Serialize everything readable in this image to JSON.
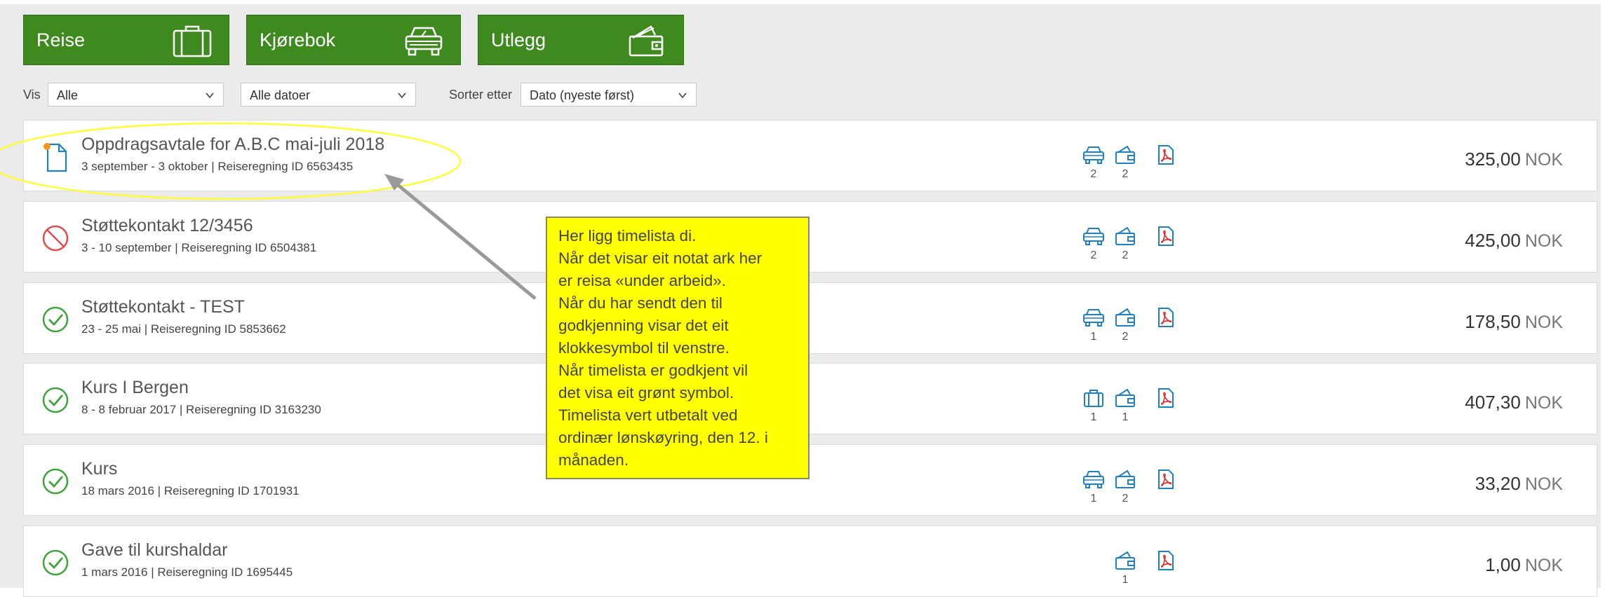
{
  "buttons": [
    {
      "label": "Reise",
      "icon": "suitcase-icon"
    },
    {
      "label": "Kjørebok",
      "icon": "car-icon"
    },
    {
      "label": "Utlegg",
      "icon": "wallet-icon"
    }
  ],
  "filters": {
    "vis_label": "Vis",
    "vis_value": "Alle",
    "date_value": "Alle datoer",
    "sort_label": "Sorter etter",
    "sort_value": "Dato (nyeste først)"
  },
  "trips": [
    {
      "status": "note-icon",
      "title": "Oppdragsavtale for A.B.C mai-juli 2018",
      "subtitle": "3 september - 3 oktober | Reiseregning ID 6563435",
      "amount": "325,00",
      "currency": "NOK",
      "icons": [
        {
          "icon": "car-icon",
          "count": "2"
        },
        {
          "icon": "wallet-icon",
          "count": "2"
        },
        {
          "icon": "pdf-icon",
          "count": ""
        }
      ]
    },
    {
      "status": "prohibited-icon",
      "title": "Støttekontakt 12/3456",
      "subtitle": "3 - 10 september | Reiseregning ID 6504381",
      "amount": "425,00",
      "currency": "NOK",
      "icons": [
        {
          "icon": "car-icon",
          "count": "2"
        },
        {
          "icon": "wallet-icon",
          "count": "2"
        },
        {
          "icon": "pdf-icon",
          "count": ""
        }
      ]
    },
    {
      "status": "check-circle-icon",
      "title": "Støttekontakt - TEST",
      "subtitle": "23 - 25 mai | Reiseregning ID 5853662",
      "amount": "178,50",
      "currency": "NOK",
      "icons": [
        {
          "icon": "car-icon",
          "count": "1"
        },
        {
          "icon": "wallet-icon",
          "count": "2"
        },
        {
          "icon": "pdf-icon",
          "count": ""
        }
      ]
    },
    {
      "status": "check-circle-icon",
      "title": "Kurs I Bergen",
      "subtitle": "8 - 8 februar 2017 | Reiseregning ID 3163230",
      "amount": "407,30",
      "currency": "NOK",
      "icons": [
        {
          "icon": "suitcase-icon",
          "count": "1"
        },
        {
          "icon": "wallet-icon",
          "count": "1"
        },
        {
          "icon": "pdf-icon",
          "count": ""
        }
      ]
    },
    {
      "status": "check-circle-icon",
      "title": "Kurs",
      "subtitle": "18 mars 2016 | Reiseregning ID 1701931",
      "amount": "33,20",
      "currency": "NOK",
      "icons": [
        {
          "icon": "car-icon",
          "count": "1"
        },
        {
          "icon": "wallet-icon",
          "count": "2"
        },
        {
          "icon": "pdf-icon",
          "count": ""
        }
      ]
    },
    {
      "status": "check-circle-icon",
      "title": "Gave til kurshaldar",
      "subtitle": "1 mars 2016 | Reiseregning ID 1695445",
      "amount": "1,00",
      "currency": "NOK",
      "icons": [
        {
          "icon": "none",
          "count": ""
        },
        {
          "icon": "wallet-icon",
          "count": "1"
        },
        {
          "icon": "pdf-icon",
          "count": ""
        }
      ]
    }
  ],
  "note": {
    "lines": [
      "Her ligg timelista di.",
      "Når det visar eit notat ark her",
      "er reisa «under arbeid».",
      "Når du har sendt den til",
      "godkjenning visar det eit",
      "klokkesymbol til venstre.",
      "Når timelista er godkjent vil",
      "det visa eit grønt symbol.",
      "Timelista vert utbetalt ved",
      "ordinær lønskøyring, den 12. i",
      "månaden."
    ]
  },
  "colors": {
    "green": "#3f8a1e",
    "icon_blue": "#1e7fc2",
    "pdf_red": "#e0272a",
    "prohibited_red": "#e04b4b",
    "check_green": "#3ea33a",
    "note_yellow": "#ffff00"
  }
}
